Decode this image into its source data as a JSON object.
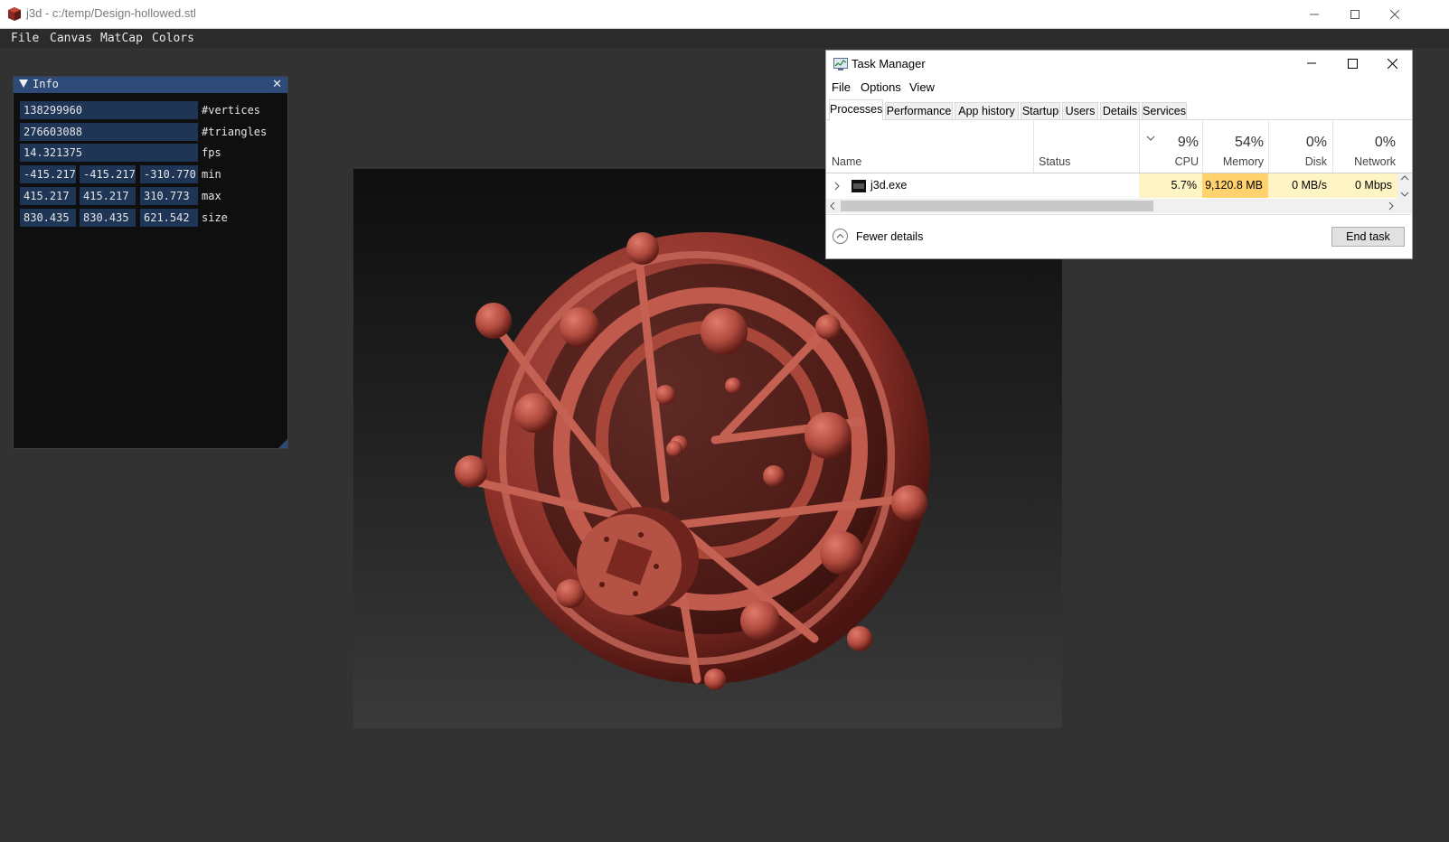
{
  "window": {
    "title": "j3d - c:/temp/Design-hollowed.stl"
  },
  "menu": {
    "items": [
      "File",
      "Canvas",
      "MatCap",
      "Colors"
    ]
  },
  "info_panel": {
    "title": "Info",
    "vertices": "138299960",
    "vertices_label": "#vertices",
    "triangles": "276603088",
    "triangles_label": "#triangles",
    "fps": "14.321375",
    "fps_label": "fps",
    "min": [
      "-415.217",
      "-415.217",
      "-310.770"
    ],
    "min_label": "min",
    "max": [
      "415.217",
      "415.217",
      "310.773"
    ],
    "max_label": "max",
    "size": [
      "830.435",
      "830.435",
      "621.542"
    ],
    "size_label": "size"
  },
  "viewport": {
    "model_color": "#b04a3e",
    "bg_top": "#0f0f0f",
    "bg_bottom": "#3a3a3a"
  },
  "task_manager": {
    "title": "Task Manager",
    "menu": [
      "File",
      "Options",
      "View"
    ],
    "tabs": [
      "Processes",
      "Performance",
      "App history",
      "Startup",
      "Users",
      "Details",
      "Services"
    ],
    "active_tab": "Processes",
    "columns": {
      "name": "Name",
      "status": "Status",
      "cpu_pct": "9%",
      "cpu": "CPU",
      "memory_pct": "54%",
      "memory": "Memory",
      "disk_pct": "0%",
      "disk": "Disk",
      "network_pct": "0%",
      "network": "Network"
    },
    "process": {
      "name": "j3d.exe",
      "status": "",
      "cpu": "5.7%",
      "memory": "9,120.8 MB",
      "disk": "0 MB/s",
      "network": "0 Mbps"
    },
    "fewer_details": "Fewer details",
    "end_task": "End task",
    "colors": {
      "cpu_cell": "#fff4c4",
      "memory_cell": "#ffd26e",
      "light_cell": "#fff4c4"
    }
  }
}
